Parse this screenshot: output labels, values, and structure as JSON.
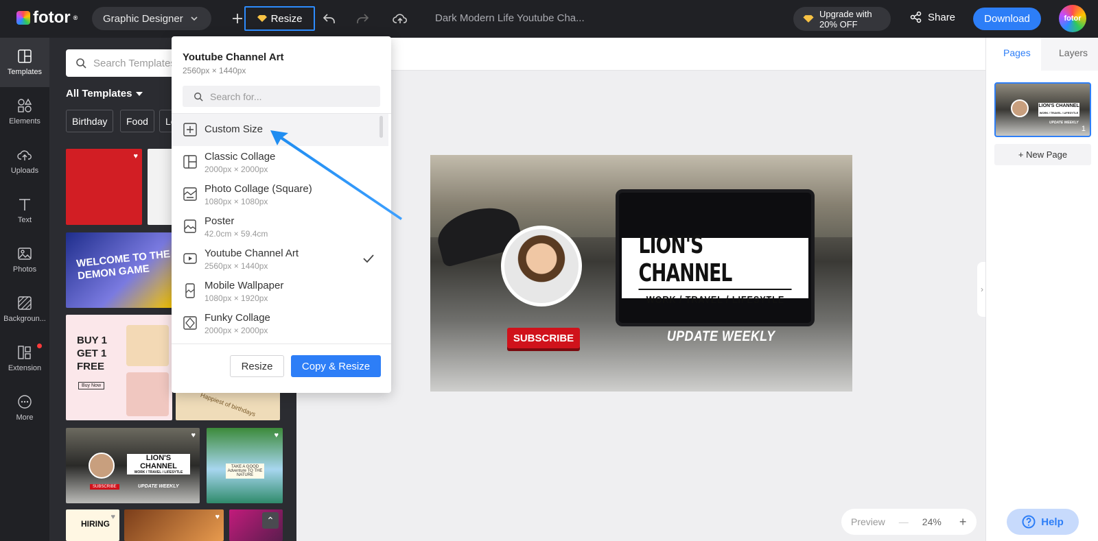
{
  "app": {
    "brand": "fotor",
    "brand_mark": "®",
    "role_label": "Graphic Designer",
    "resize_label": "Resize",
    "doc_title": "Dark Modern Life Youtube Cha...",
    "upgrade_line1": "Upgrade with",
    "upgrade_line2": "20% OFF",
    "share_label": "Share",
    "download_label": "Download",
    "avatar_label": "fotor"
  },
  "leftnav": {
    "items": [
      {
        "label": "Templates",
        "icon": "templates-icon"
      },
      {
        "label": "Elements",
        "icon": "elements-icon"
      },
      {
        "label": "Uploads",
        "icon": "upload-icon"
      },
      {
        "label": "Text",
        "icon": "text-icon"
      },
      {
        "label": "Photos",
        "icon": "photos-icon"
      },
      {
        "label": "Backgroun...",
        "icon": "background-icon"
      },
      {
        "label": "Extension",
        "icon": "extension-icon"
      },
      {
        "label": "More",
        "icon": "more-icon"
      }
    ]
  },
  "templates": {
    "search_placeholder": "Search Templates",
    "all_label": "All Templates",
    "chips": [
      "Birthday",
      "Food",
      "Le"
    ],
    "cards": [
      {
        "text": ""
      },
      {
        "text": "WELCOME TO THE DEMON GAME"
      },
      {
        "text": "BUY 1 GET 1 FREE"
      },
      {
        "text": "Buy Now"
      },
      {
        "text": "Happiest of birthdays"
      },
      {
        "text": "LION'S CHANNEL"
      },
      {
        "text": "WORK / TRAVEL / LIFESYTLE"
      },
      {
        "text": "SUBSCRIBE"
      },
      {
        "text": "UPDATE WEEKLY"
      },
      {
        "text": "TAKE A GOOD Adventure TO THE NATURE"
      },
      {
        "text": "HIRING"
      }
    ]
  },
  "resize_menu": {
    "current_title": "Youtube Channel Art",
    "current_dims": "2560px × 1440px",
    "search_placeholder": "Search for...",
    "items": [
      {
        "name": "Custom Size",
        "size": "",
        "icon": "plus-square-icon"
      },
      {
        "name": "Classic Collage",
        "size": "2000px × 2000px",
        "icon": "collage-icon"
      },
      {
        "name": "Photo Collage (Square)",
        "size": "1080px × 1080px",
        "icon": "photo-collage-icon"
      },
      {
        "name": "Poster",
        "size": "42.0cm × 59.4cm",
        "icon": "poster-icon"
      },
      {
        "name": "Youtube Channel Art",
        "size": "2560px × 1440px",
        "icon": "youtube-icon",
        "selected": true
      },
      {
        "name": "Mobile Wallpaper",
        "size": "1080px × 1920px",
        "icon": "mobile-icon"
      },
      {
        "name": "Funky Collage",
        "size": "2000px × 2000px",
        "icon": "funky-collage-icon"
      }
    ],
    "resize_button": "Resize",
    "copy_resize_button": "Copy & Resize"
  },
  "artboard": {
    "title": "LION'S CHANNEL",
    "subtitle": "WORK / TRAVEL / LIFESYTLE",
    "subscribe": "SUBSCRIBE",
    "update": "UPDATE WEEKLY"
  },
  "zoom": {
    "preview_label": "Preview",
    "minus": "—",
    "value": "24%",
    "plus": "+"
  },
  "rightpanel": {
    "tab_pages": "Pages",
    "tab_layers": "Layers",
    "thumb_title": "LION'S CHANNEL",
    "thumb_sub": "WORK / TRAVEL / LIFESYTLE",
    "thumb_update": "UPDATE WEEKLY",
    "page_number": "1",
    "new_page_label": "+ New Page"
  },
  "help_label": "Help",
  "colors": {
    "accent": "#2d7ef7",
    "topbar": "#202125",
    "panel": "#2b2c31"
  }
}
